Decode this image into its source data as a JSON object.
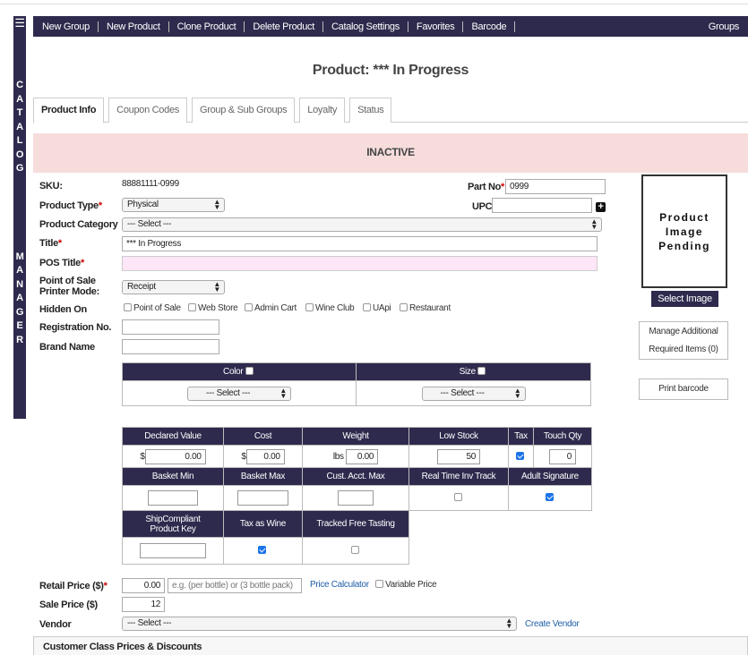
{
  "sidebar": {
    "menu_icon": "menu-icon",
    "word1": [
      "C",
      "A",
      "T",
      "A",
      "L",
      "O",
      "G"
    ],
    "word2": [
      "M",
      "A",
      "N",
      "A",
      "G",
      "E",
      "R"
    ]
  },
  "topnav": {
    "items": [
      "New Group",
      "New Product",
      "Clone Product",
      "Delete Product",
      "Catalog Settings",
      "Favorites",
      "Barcode"
    ],
    "right": "Groups"
  },
  "page_title": "Product: *** In Progress",
  "tabs": [
    "Product Info",
    "Coupon Codes",
    "Group & Sub Groups",
    "Loyalty",
    "Status"
  ],
  "banner": "INACTIVE",
  "form": {
    "sku_label": "SKU:",
    "sku_value": "88881111-0999",
    "part_label": "Part No",
    "part_value": "0999",
    "type_label": "Product Type",
    "type_value": "Physical",
    "upc_label": "UPC",
    "upc_value": "",
    "category_label": "Product Category",
    "category_value": "--- Select ---",
    "title_label": "Title",
    "title_value": "*** In Progress",
    "pos_title_label": "POS Title",
    "pos_title_value": "",
    "printer_label_1": "Point of Sale",
    "printer_label_2": "Printer Mode:",
    "printer_value": "Receipt",
    "hidden_label": "Hidden On",
    "hidden_options": [
      "Point of Sale",
      "Web Store",
      "Admin Cart",
      "Wine Club",
      "UApi",
      "Restaurant"
    ],
    "reg_label": "Registration No.",
    "reg_value": "",
    "brand_label": "Brand Name",
    "brand_value": ""
  },
  "image_panel": {
    "line1": "Product",
    "line2": "Image",
    "line3": "Pending",
    "select_button": "Select Image",
    "manage_1": "Manage Additional",
    "manage_2": "Required Items (0)",
    "print_button": "Print barcode"
  },
  "variants": {
    "color_label": "Color",
    "size_label": "Size",
    "color_select": "--- Select ---",
    "size_select": "--- Select ---"
  },
  "metrics": {
    "h1": [
      "Declared Value",
      "Cost",
      "Weight",
      "Low Stock",
      "Tax",
      "Touch Qty"
    ],
    "declared_prefix": "$",
    "declared": "0.00",
    "cost_prefix": "$",
    "cost": "0.00",
    "weight_prefix": "lbs",
    "weight": "0.00",
    "low_stock": "50",
    "touch_qty": "0",
    "h2": [
      "Basket Min",
      "Basket Max",
      "Cust. Acct. Max",
      "Real Time Inv Track",
      "Adult Signature"
    ],
    "h3_1a": "ShipCompliant",
    "h3_1b": "Product Key",
    "h3_2": "Tax as Wine",
    "h3_3": "Tracked Free Tasting"
  },
  "pricing": {
    "retail_label": "Retail Price ($)",
    "retail_value": "0.00",
    "retail_placeholder": "e.g. (per bottle) or (3 bottle pack)",
    "price_calc": "Price Calculator",
    "variable_price": "Variable Price",
    "sale_label": "Sale Price ($)",
    "sale_value": "12",
    "vendor_label": "Vendor",
    "vendor_value": "--- Select ---",
    "create_vendor": "Create Vendor"
  },
  "customer_class": "Customer Class Prices & Discounts",
  "colors": {
    "nav": "#2e2a4d",
    "banner": "#f7dcdc",
    "pos_title_bg": "#fde6f7",
    "link": "#1f5fa8",
    "required": "#cc0000"
  }
}
